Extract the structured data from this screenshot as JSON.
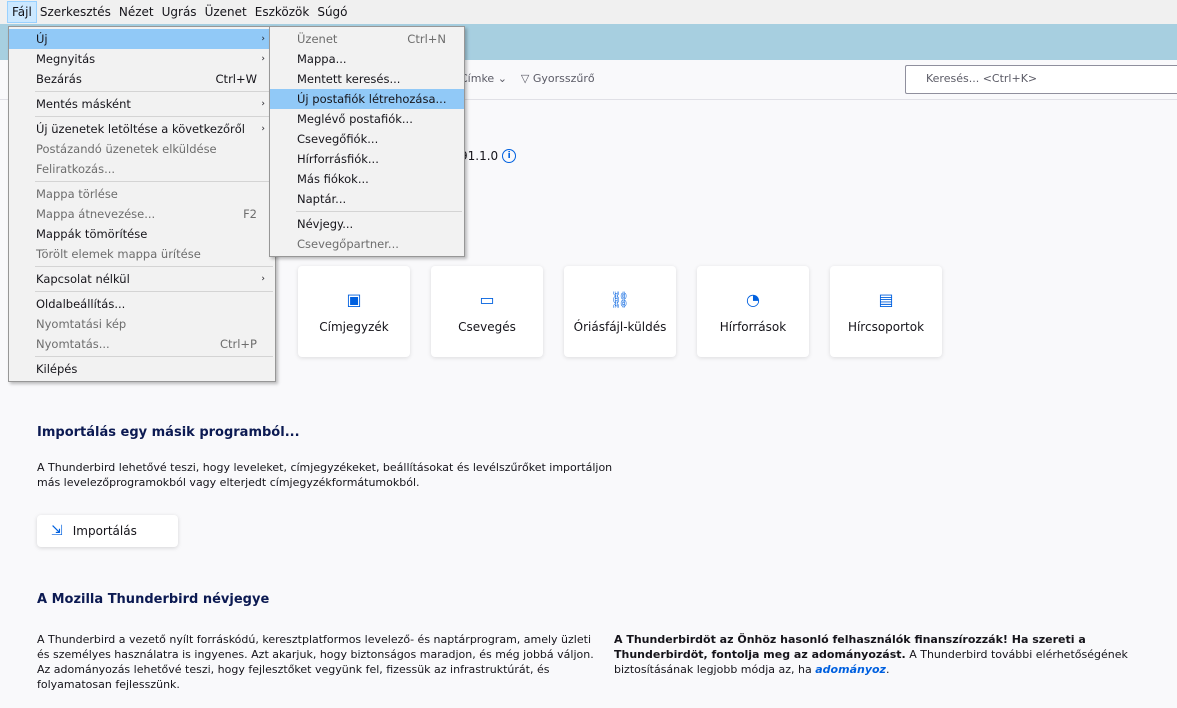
{
  "menubar": [
    "Fájl",
    "Szerkesztés",
    "Nézet",
    "Ugrás",
    "Üzenet",
    "Eszközök",
    "Súgó"
  ],
  "toolbar": {
    "cimke": "Címke",
    "gyorsszuro": "Gyorsszűrő",
    "search_placeholder": "Keresés... <Ctrl+K>"
  },
  "version": "91.1.0",
  "file_menu": [
    {
      "label": "Új",
      "shortcut": "",
      "submenu": true,
      "highlight": true,
      "disabled": false
    },
    {
      "label": "Megnyitás",
      "shortcut": "",
      "submenu": true,
      "disabled": false
    },
    {
      "label": "Bezárás",
      "shortcut": "Ctrl+W",
      "disabled": false
    },
    {
      "sep": true
    },
    {
      "label": "Mentés másként",
      "shortcut": "",
      "submenu": true,
      "disabled": false
    },
    {
      "sep": true
    },
    {
      "label": "Új üzenetek letöltése a következőről",
      "shortcut": "",
      "submenu": true,
      "disabled": false
    },
    {
      "label": "Postázandó üzenetek elküldése",
      "shortcut": "",
      "disabled": true
    },
    {
      "label": "Feliratkozás...",
      "shortcut": "",
      "disabled": true
    },
    {
      "sep": true
    },
    {
      "label": "Mappa törlése",
      "shortcut": "",
      "disabled": true
    },
    {
      "label": "Mappa átnevezése...",
      "shortcut": "F2",
      "disabled": true
    },
    {
      "label": "Mappák tömörítése",
      "shortcut": "",
      "disabled": false
    },
    {
      "label": "Törölt elemek mappa ürítése",
      "shortcut": "",
      "disabled": true
    },
    {
      "sep": true
    },
    {
      "label": "Kapcsolat nélkül",
      "shortcut": "",
      "submenu": true,
      "disabled": false
    },
    {
      "sep": true
    },
    {
      "label": "Oldalbeállítás...",
      "shortcut": "",
      "disabled": false
    },
    {
      "label": "Nyomtatási kép",
      "shortcut": "",
      "disabled": true
    },
    {
      "label": "Nyomtatás...",
      "shortcut": "Ctrl+P",
      "disabled": true
    },
    {
      "sep": true
    },
    {
      "label": "Kilépés",
      "shortcut": "",
      "disabled": false
    }
  ],
  "new_menu": [
    {
      "label": "Üzenet",
      "shortcut": "Ctrl+N",
      "disabled": true
    },
    {
      "label": "Mappa...",
      "shortcut": "",
      "disabled": false
    },
    {
      "label": "Mentett keresés...",
      "shortcut": "",
      "disabled": false
    },
    {
      "label": "Új postafiók létrehozása...",
      "shortcut": "",
      "disabled": false,
      "highlight": true
    },
    {
      "label": "Meglévő postafiók...",
      "shortcut": "",
      "disabled": false
    },
    {
      "label": "Csevegőfiók...",
      "shortcut": "",
      "disabled": false
    },
    {
      "label": "Hírforrásfiók...",
      "shortcut": "",
      "disabled": false
    },
    {
      "label": "Más fiókok...",
      "shortcut": "",
      "disabled": false
    },
    {
      "label": "Naptár...",
      "shortcut": "",
      "disabled": false
    },
    {
      "sep": true
    },
    {
      "label": "Névjegy...",
      "shortcut": "",
      "disabled": false
    },
    {
      "label": "Csevegőpartner...",
      "shortcut": "",
      "disabled": true
    }
  ],
  "tiles": [
    {
      "label": "Címjegyzék",
      "icon": "address-book-icon",
      "glyph": "▣"
    },
    {
      "label": "Csevegés",
      "icon": "chat-icon",
      "glyph": "▭"
    },
    {
      "label": "Óriásfájl-küldés",
      "icon": "link-icon",
      "glyph": "⛓"
    },
    {
      "label": "Hírforrások",
      "icon": "rss-icon",
      "glyph": "◔"
    },
    {
      "label": "Hírcsoportok",
      "icon": "newsgroup-icon",
      "glyph": "▤"
    }
  ],
  "import": {
    "title": "Importálás egy másik programból...",
    "text": "A Thunderbird lehetővé teszi, hogy leveleket, címjegyzékeket, beállításokat és levélszűrőket importáljon más levelezőprogramokból vagy elterjedt címjegyzékformátumokból.",
    "button": "Importálás"
  },
  "about": {
    "title": "A Mozilla Thunderbird névjegye",
    "text": "A Thunderbird a vezető nyílt forráskódú, keresztplatformos levelező- és naptárprogram, amely üzleti és személyes használatra is ingyenes. Azt akarjuk, hogy biztonságos maradjon, és még jobbá váljon. Az adományozás lehetővé teszi, hogy fejlesztőket vegyünk fel, fizessük az infrastruktúrát, és folyamatosan fejlesszünk.",
    "donate_bold": "A Thunderbirdöt az Önhöz hasonló felhasználók finanszírozzák! Ha szereti a Thunderbirdöt, fontolja meg az adományozást.",
    "donate_rest": "A Thunderbird további elérhetőségének biztosításának legjobb módja az, ha",
    "donate_link": "adományoz"
  }
}
